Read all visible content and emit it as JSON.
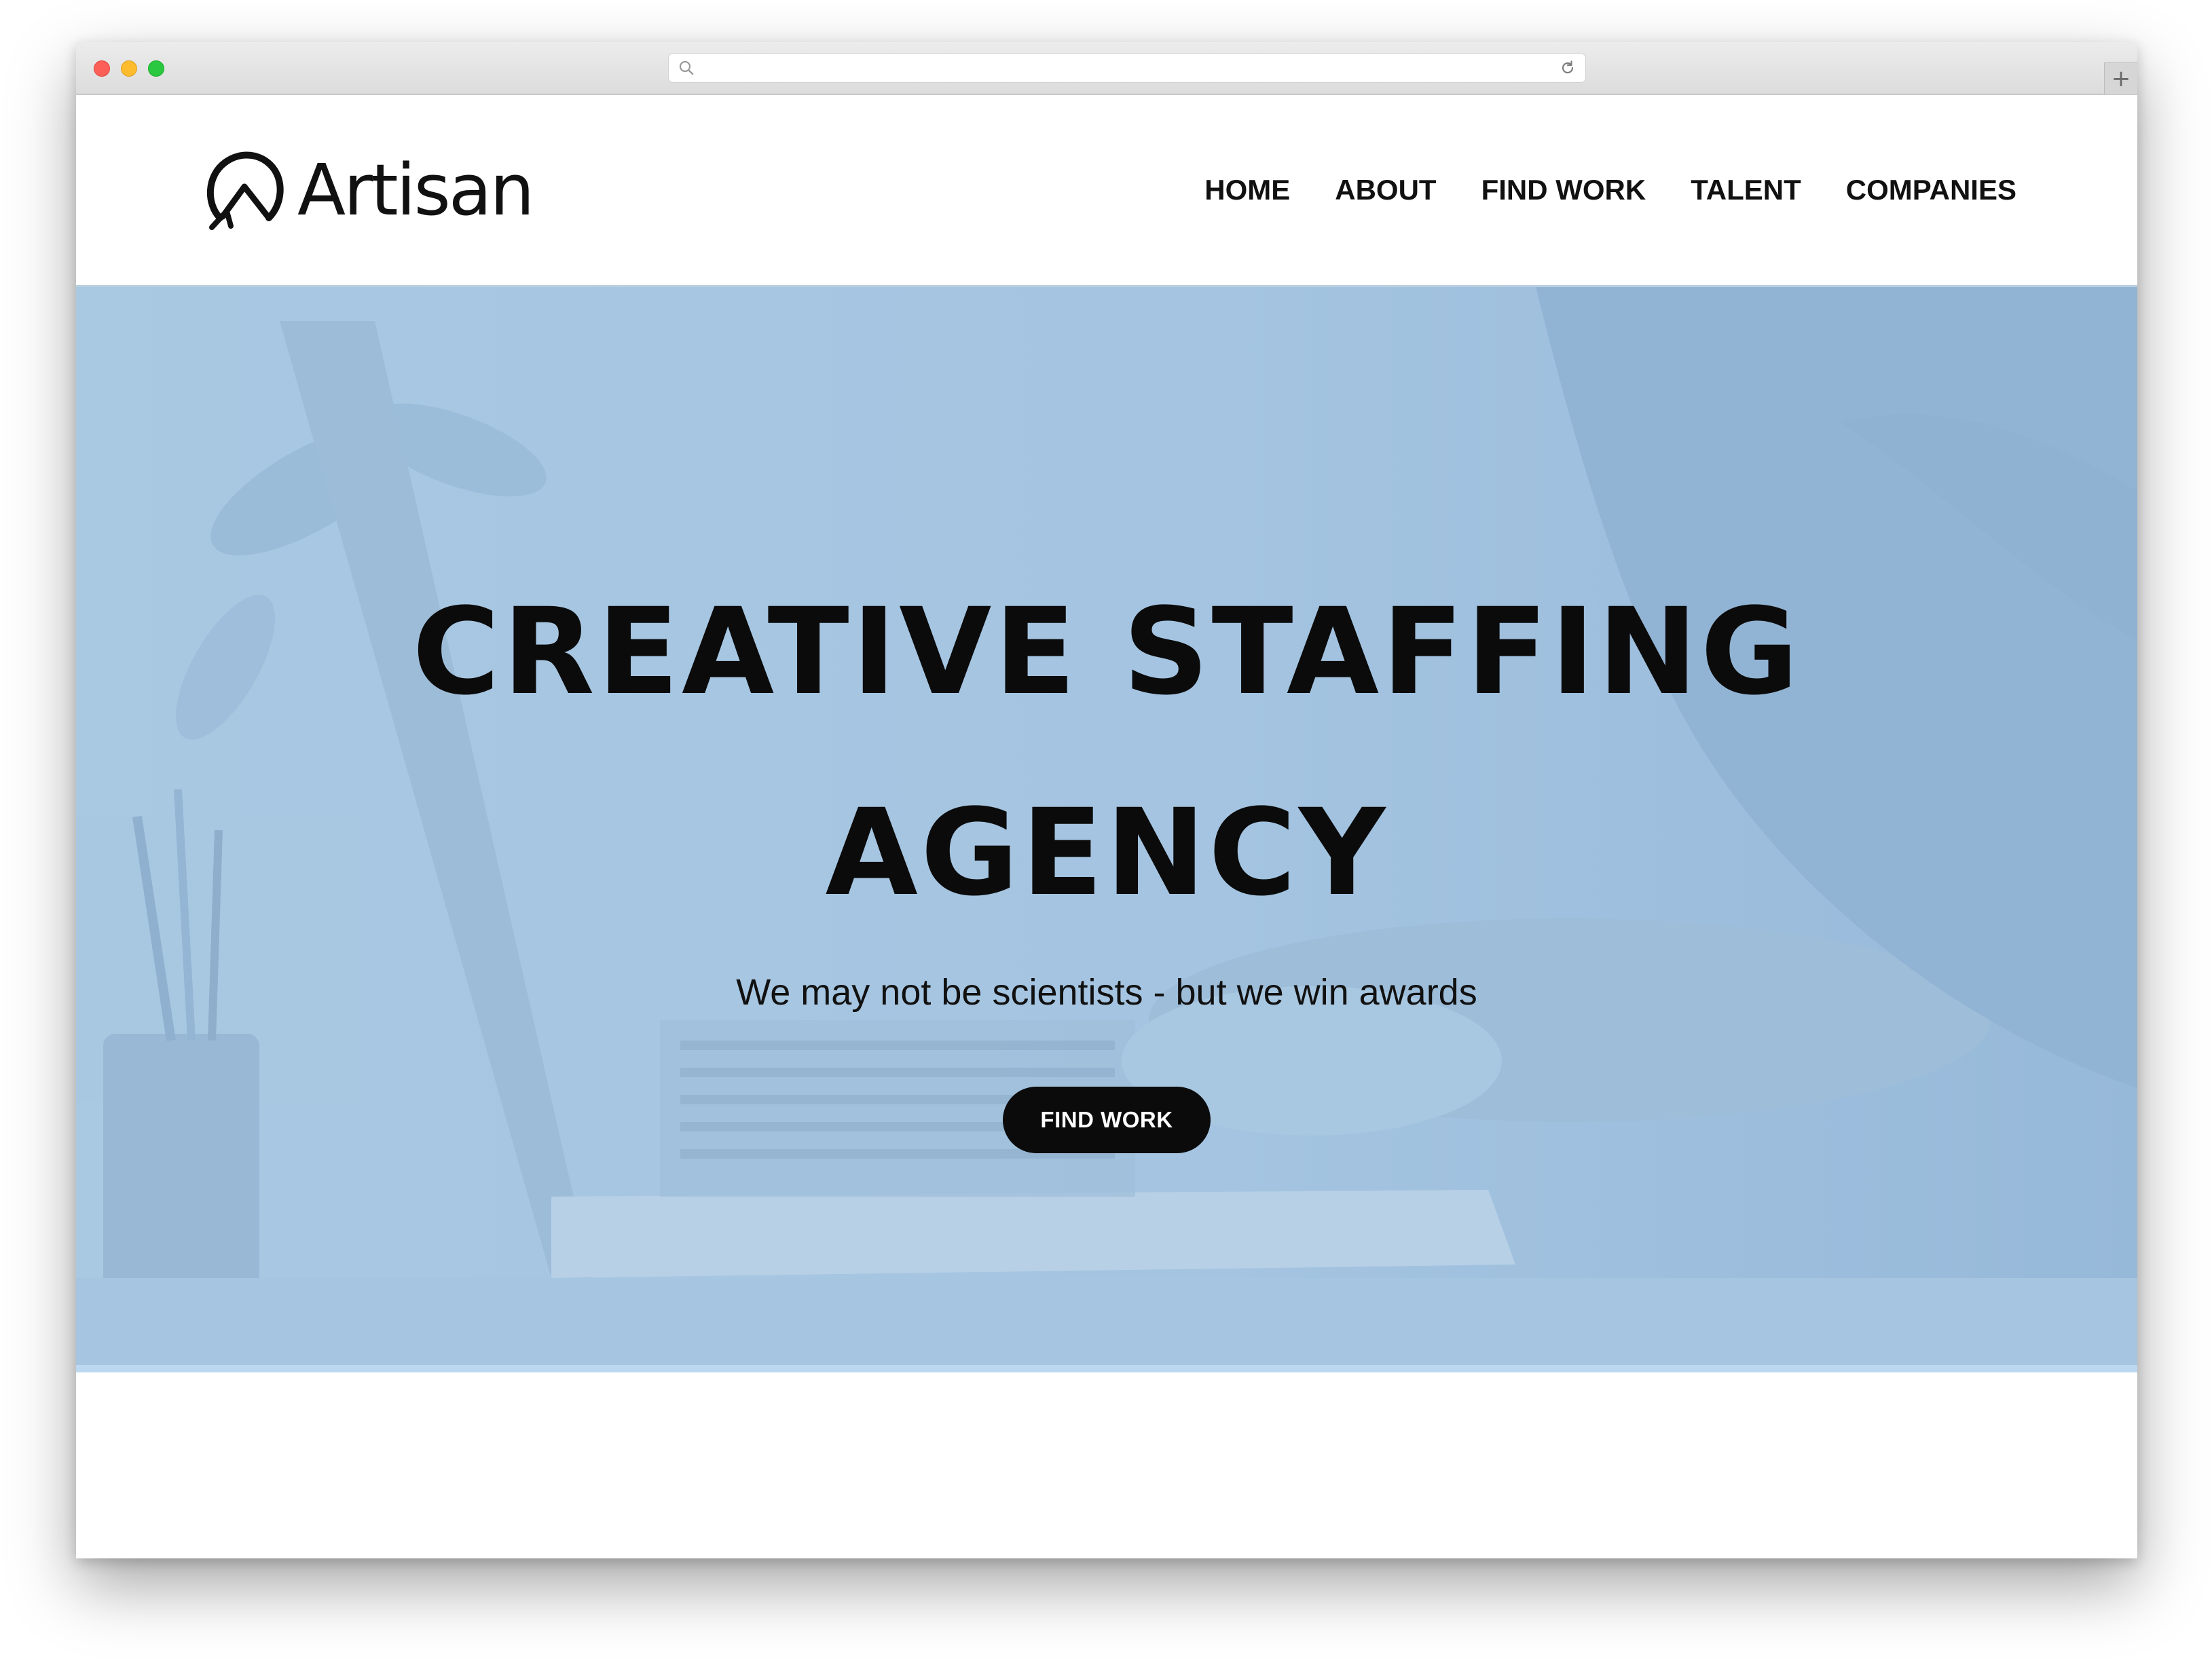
{
  "browser": {
    "url": "",
    "new_tab_symbol": "+",
    "icons": [
      "search-icon",
      "reload-icon",
      "new-tab-icon"
    ]
  },
  "header": {
    "logo_text": "Artisan",
    "nav": [
      {
        "label": "HOME"
      },
      {
        "label": "ABOUT"
      },
      {
        "label": "FIND WORK"
      },
      {
        "label": "TALENT"
      },
      {
        "label": "COMPANIES"
      }
    ]
  },
  "hero": {
    "title_line1": "CREATIVE STAFFING",
    "title_line2": "AGENCY",
    "subtitle": "We may not be scientists - but we win awards",
    "cta_label": "FIND WORK"
  },
  "colors": {
    "hero_overlay": "#a3c3e0",
    "cta_background": "#0b0b0b",
    "cta_text": "#ffffff",
    "text_primary": "#111111"
  }
}
